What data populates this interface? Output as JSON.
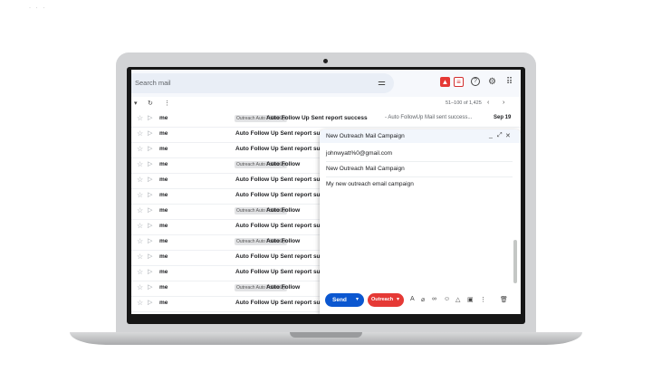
{
  "search": {
    "placeholder": "Search mail"
  },
  "toolbar": {
    "count": "51–100 of 1,425"
  },
  "rows": [
    {
      "sender": "me",
      "label": "Outreach Auto FollowUp",
      "subject": "Auto Follow Up Sent report success",
      "snippet": "- Auto FollowUp Mail sent success...",
      "date": "Sep 19"
    },
    {
      "sender": "me",
      "label": "",
      "subject": "Auto Follow Up Sent report succ"
    },
    {
      "sender": "me",
      "label": "",
      "subject": "Auto Follow Up Sent report succ"
    },
    {
      "sender": "me",
      "label": "Outreach Auto FollowUp",
      "subject": "Auto Follow"
    },
    {
      "sender": "me",
      "label": "",
      "subject": "Auto Follow Up Sent report succ"
    },
    {
      "sender": "me",
      "label": "",
      "subject": "Auto Follow Up Sent report succ"
    },
    {
      "sender": "me",
      "label": "Outreach Auto FollowUp",
      "subject": "Auto Follow"
    },
    {
      "sender": "me",
      "label": "",
      "subject": "Auto Follow Up Sent report succ"
    },
    {
      "sender": "me",
      "label": "Outreach Auto FollowUp",
      "subject": "Auto Follow"
    },
    {
      "sender": "me",
      "label": "",
      "subject": "Auto Follow Up Sent report succ"
    },
    {
      "sender": "me",
      "label": "",
      "subject": "Auto Follow Up Sent report succ"
    },
    {
      "sender": "me",
      "label": "Outreach Auto FollowUp",
      "subject": "Auto Follow"
    },
    {
      "sender": "me",
      "label": "",
      "subject": "Auto Follow Up Sent report succ"
    }
  ],
  "compose": {
    "title": "New Outreach Mail Campaign",
    "to": "johnwyatt%0@gmail.com",
    "subject": "New Outreach Mail Campaign",
    "body": "My new outreach email campaign",
    "send_label": "Send",
    "outreach_label": "Outreach"
  },
  "colors": {
    "send": "#0b57d0",
    "outreach": "#e53935"
  }
}
